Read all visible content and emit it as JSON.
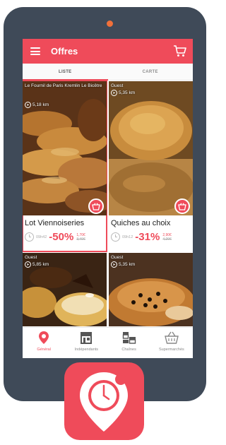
{
  "colors": {
    "accent": "#ef4b5a",
    "phone": "#3f4a58",
    "camera": "#f0703a"
  },
  "header": {
    "title": "Offres",
    "menu_icon": "hamburger-menu-icon",
    "cart_icon": "shopping-cart-icon"
  },
  "tabs": [
    {
      "label": "LISTE",
      "active": true
    },
    {
      "label": "CARTE",
      "active": false
    }
  ],
  "offers": [
    {
      "shop": "Le Fournil de Paris Kremlin Le Bicêtre",
      "distance": "5,18 km",
      "title": "Lot Viennoiseries",
      "time": "09h42",
      "discount": "-50%",
      "new_price": "1,70€",
      "old_price": "3,40€"
    },
    {
      "shop": "Guest",
      "distance": "5,35 km",
      "title": "Quiches au choix",
      "time": "09h12",
      "discount": "-31%",
      "new_price": "2,90€",
      "old_price": "4,20€"
    },
    {
      "shop": "Guest",
      "distance": "5,85 km"
    },
    {
      "shop": "Guest",
      "distance": "5,35 km"
    }
  ],
  "bottom_nav": [
    {
      "label": "Général",
      "icon": "map-pin-icon",
      "active": true
    },
    {
      "label": "Indépendants",
      "icon": "storefront-icon",
      "active": false
    },
    {
      "label": "Chaînes",
      "icon": "chain-stores-icon",
      "active": false
    },
    {
      "label": "Supermarchés",
      "icon": "shopping-basket-icon",
      "active": false
    }
  ],
  "app_icon": "app-logo-icon"
}
